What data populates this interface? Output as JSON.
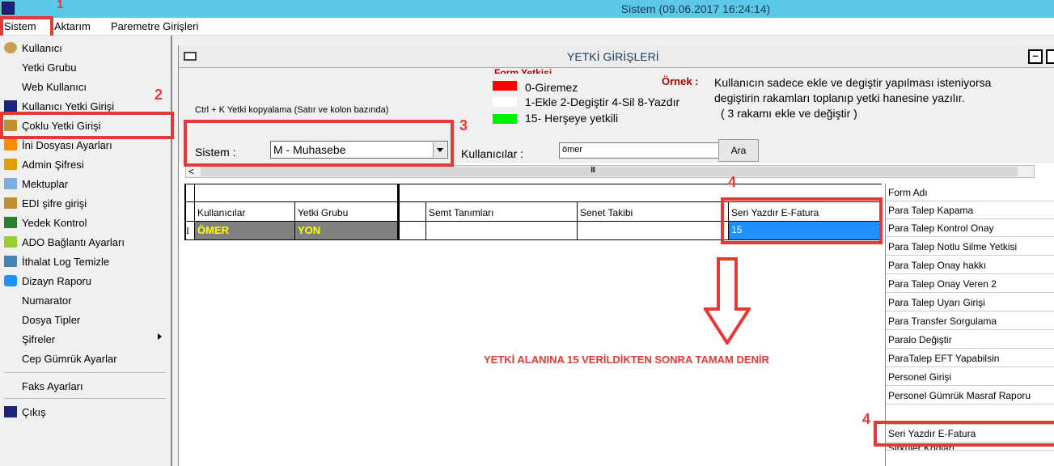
{
  "window": {
    "title": "Sistem (09.06.2017 16:24:14)"
  },
  "menubar": {
    "items": [
      "Sistem",
      "Aktarım",
      "Paremetre Girişleri"
    ]
  },
  "dropdown": {
    "items": [
      "Kullanıcı",
      "Yetki Grubu",
      "Web Kullanıcı",
      "Kullanıcı Yetki Girişi",
      "Çoklu Yetki Girişi",
      "İni Dosyası Ayarları",
      "Admin Şifresi",
      "Mektuplar",
      "EDI şifre girişi",
      "Yedek Kontrol",
      "ADO Bağlantı Ayarları",
      "İthalat Log Temizle",
      "Dizayn Raporu",
      "Numarator",
      "Dosya Tipler",
      "Şifreler",
      "Cep Gümrük Ayarlar",
      "Faks Ayarları",
      "Çıkış"
    ]
  },
  "annotations": {
    "n1": "1",
    "n2": "2",
    "n3": "3",
    "n4a": "4",
    "n4b": "4"
  },
  "panel": {
    "title": "YETKİ GİRİŞLERİ",
    "ctrlk": "Ctrl + K Yetki kopyalama (Satır ve kolon bazında)",
    "form_yetkisi": "Form Yetkisi",
    "legend": [
      "0-Giremez",
      "1-Ekle  2-Degiştir  4-Sil  8-Yazdır",
      "15- Herşeye yetkili"
    ],
    "ornek_label": "Örnek :",
    "explanation": [
      "Kullanıcın sadece ekle ve degiştir yapılması isteniyorsa",
      "degiştirin rakamları toplanıp yetki hanesine yazılır.",
      "( 3 rakamı ekle ve değiştir )"
    ],
    "sistem_label": "Sistem :",
    "sistem_value": "M - Muhasebe",
    "kullanicilar_label": "Kullanıcılar :",
    "kullanicilar_value": "ömer",
    "ara_label": "Ara",
    "scroll_grip": "III",
    "scroll_left": "<"
  },
  "grid": {
    "headers": [
      "Kullanıcılar",
      "Yetki Grubu",
      "Semt Tanımları",
      "Senet Takibi",
      "Seri Yazdır E-Fatura"
    ],
    "row_indicator": "I",
    "row": {
      "kullanici": "ÖMER",
      "yetki_grubu": "YON",
      "seri_yazdir": "15"
    }
  },
  "instruction": "YETKİ ALANINA 15 VERİLDİKTEN SONRA  TAMAM DENİR",
  "form_list": {
    "header": "Form Adı",
    "items": [
      "Para Talep Kapama",
      "Para Talep Kontrol Onay",
      "Para Talep Notlu Silme Yetkisi",
      "Para Talep Onay hakkı",
      "Para Talep Onay Veren 2",
      "Para Talep Uyarı Girişi",
      "Para Transfer Sorgulama",
      "Paralo Değiştir",
      "ParaTalep EFT Yapabilsin",
      "Personel Girişi",
      "Personel Gümrük Masraf Raporu",
      "",
      "Seri Yazdır E-Fatura",
      "Sirküler Kodları"
    ]
  },
  "colors": {
    "titlebar": "#5bc8e8",
    "annotation": "#e53935",
    "selected_cell": "#1e90ff",
    "readonly_cell": "#808080",
    "readonly_text": "#ffff00",
    "legend_red": "#ff0000",
    "legend_white": "#ffffff",
    "legend_green": "#00ee00"
  }
}
